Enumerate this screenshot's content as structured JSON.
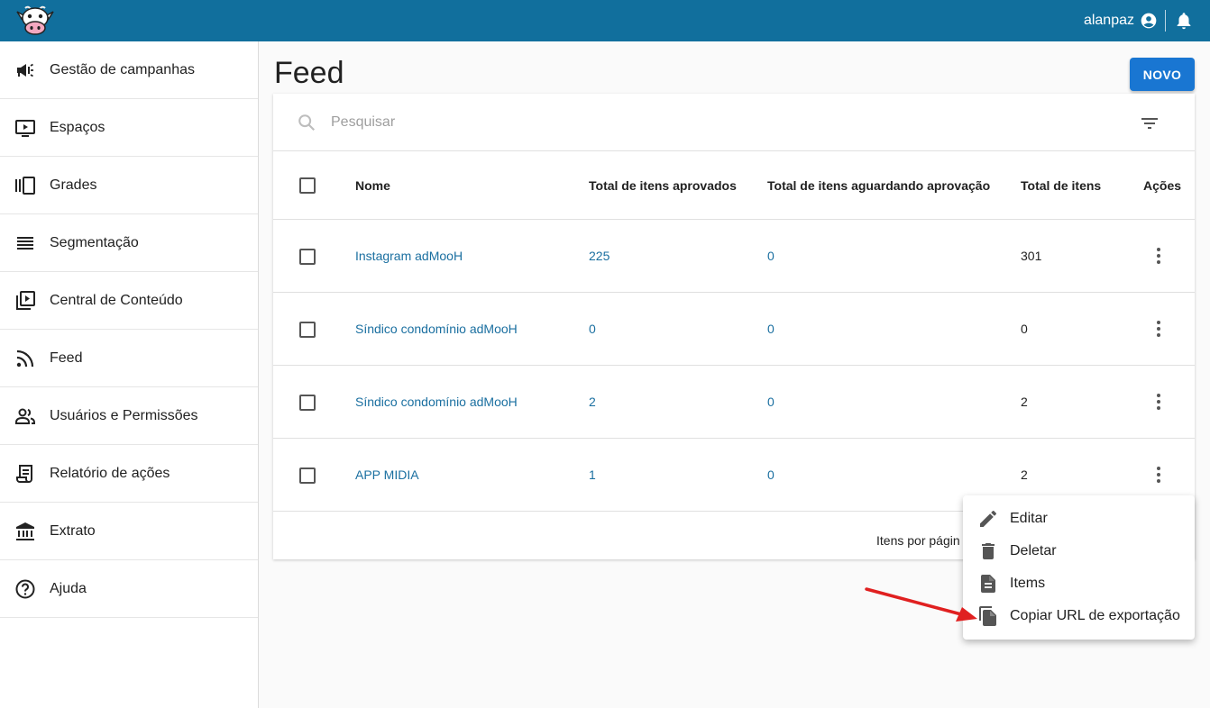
{
  "topbar": {
    "username": "alanpaz",
    "brand_color": "#116f9d"
  },
  "sidebar": {
    "items": [
      {
        "label": "Gestão de campanhas",
        "icon": "megaphone-icon"
      },
      {
        "label": "Espaços",
        "icon": "screen-play-icon"
      },
      {
        "label": "Grades",
        "icon": "carousel-icon"
      },
      {
        "label": "Segmentação",
        "icon": "lines-icon"
      },
      {
        "label": "Central de Conteúdo",
        "icon": "video-library-icon"
      },
      {
        "label": "Feed",
        "icon": "rss-feed-icon"
      },
      {
        "label": "Usuários e Permissões",
        "icon": "people-icon"
      },
      {
        "label": "Relatório de ações",
        "icon": "receipt-icon"
      },
      {
        "label": "Extrato",
        "icon": "bank-icon"
      },
      {
        "label": "Ajuda",
        "icon": "help-icon"
      }
    ]
  },
  "page": {
    "title": "Feed",
    "new_button": "NOVO"
  },
  "search": {
    "placeholder": "Pesquisar"
  },
  "table": {
    "headers": {
      "name": "Nome",
      "approved": "Total de itens aprovados",
      "pending": "Total de itens aguardando aprovação",
      "total": "Total de itens",
      "actions": "Ações"
    },
    "rows": [
      {
        "name": "Instagram adMooH",
        "approved": "225",
        "pending": "0",
        "total": "301"
      },
      {
        "name": "Síndico condomínio adMooH",
        "approved": "0",
        "pending": "0",
        "total": "0"
      },
      {
        "name": "Síndico condomínio adMooH",
        "approved": "2",
        "pending": "0",
        "total": "2"
      },
      {
        "name": "APP MIDIA",
        "approved": "1",
        "pending": "0",
        "total": "2"
      }
    ],
    "footer": "Itens por págin"
  },
  "menu": {
    "items": [
      {
        "label": "Editar",
        "icon": "pencil-icon"
      },
      {
        "label": "Deletar",
        "icon": "trash-icon"
      },
      {
        "label": "Items",
        "icon": "document-icon"
      },
      {
        "label": "Copiar URL de exportação",
        "icon": "copy-document-icon"
      }
    ]
  },
  "colors": {
    "primary_button": "#1976d2",
    "link": "#1a6fa0",
    "annotation_arrow": "#e02020"
  }
}
